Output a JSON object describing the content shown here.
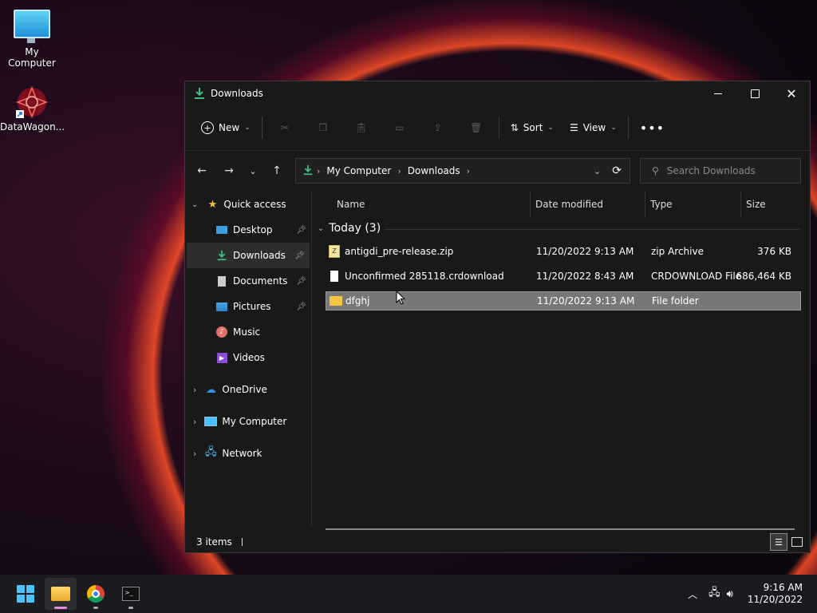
{
  "desktop": {
    "icons": [
      {
        "label": "My Computer",
        "icon": "monitor-icon"
      },
      {
        "label": "DataWagon...",
        "icon": "datawagon-icon"
      }
    ]
  },
  "window": {
    "title": "Downloads",
    "title_icon": "download-icon",
    "controls": [
      "minimize-icon",
      "maximize-icon",
      "close-icon"
    ]
  },
  "toolbar": {
    "new_label": "New",
    "sort_label": "Sort",
    "view_label": "View",
    "actions": [
      "cut-icon",
      "copy-icon",
      "paste-icon",
      "rename-icon",
      "share-icon",
      "delete-icon"
    ]
  },
  "address": {
    "crumbs": [
      "My Computer",
      "Downloads"
    ]
  },
  "search": {
    "placeholder": "Search Downloads"
  },
  "sidebar": {
    "quick_access": "Quick access",
    "items": [
      {
        "label": "Desktop",
        "icon": "desktop-icon",
        "pinned": true
      },
      {
        "label": "Downloads",
        "icon": "download-icon",
        "pinned": true
      },
      {
        "label": "Documents",
        "icon": "document-icon",
        "pinned": true
      },
      {
        "label": "Pictures",
        "icon": "picture-icon",
        "pinned": true
      },
      {
        "label": "Music",
        "icon": "music-icon",
        "pinned": false
      },
      {
        "label": "Videos",
        "icon": "video-icon",
        "pinned": false
      }
    ],
    "roots": [
      {
        "label": "OneDrive",
        "icon": "cloud-icon"
      },
      {
        "label": "My Computer",
        "icon": "monitor-icon"
      },
      {
        "label": "Network",
        "icon": "network-icon"
      }
    ]
  },
  "columns": [
    "Name",
    "Date modified",
    "Type",
    "Size"
  ],
  "group": {
    "label": "Today (3)"
  },
  "files": [
    {
      "name": "antigdi_pre-release.zip",
      "date": "11/20/2022 9:13 AM",
      "type": "zip Archive",
      "size": "376 KB",
      "icon": "zip-icon"
    },
    {
      "name": "Unconfirmed 285118.crdownload",
      "date": "11/20/2022 8:43 AM",
      "type": "CRDOWNLOAD File",
      "size": "686,464 KB",
      "icon": "file-icon"
    },
    {
      "name": "dfghj",
      "date": "11/20/2022 9:13 AM",
      "type": "File folder",
      "size": "",
      "icon": "folder-icon",
      "selected": true
    }
  ],
  "status": {
    "items": "3 items"
  },
  "taskbar": {
    "apps": [
      "windows-start-icon",
      "file-explorer-icon",
      "chrome-icon",
      "terminal-icon"
    ],
    "time": "9:16 AM",
    "date": "11/20/2022"
  },
  "colors": {
    "accent": "#4cc2ff",
    "download_green": "#3fbf7f",
    "folder_yellow": "#f5c542",
    "selection": "#777777"
  }
}
